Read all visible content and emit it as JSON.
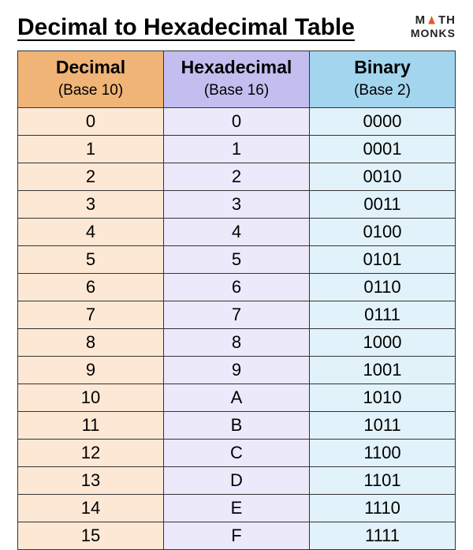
{
  "title": "Decimal to Hexadecimal Table",
  "logo": {
    "line1_left": "M",
    "line1_right": "TH",
    "line2": "MONKS"
  },
  "columns": [
    {
      "name": "Decimal",
      "base": "(Base 10)"
    },
    {
      "name": "Hexadecimal",
      "base": "(Base 16)"
    },
    {
      "name": "Binary",
      "base": "(Base 2)"
    }
  ],
  "rows": [
    {
      "decimal": "0",
      "hex": "0",
      "binary": "0000"
    },
    {
      "decimal": "1",
      "hex": "1",
      "binary": "0001"
    },
    {
      "decimal": "2",
      "hex": "2",
      "binary": "0010"
    },
    {
      "decimal": "3",
      "hex": "3",
      "binary": "0011"
    },
    {
      "decimal": "4",
      "hex": "4",
      "binary": "0100"
    },
    {
      "decimal": "5",
      "hex": "5",
      "binary": "0101"
    },
    {
      "decimal": "6",
      "hex": "6",
      "binary": "0110"
    },
    {
      "decimal": "7",
      "hex": "7",
      "binary": "0111"
    },
    {
      "decimal": "8",
      "hex": "8",
      "binary": "1000"
    },
    {
      "decimal": "9",
      "hex": "9",
      "binary": "1001"
    },
    {
      "decimal": "10",
      "hex": "A",
      "binary": "1010"
    },
    {
      "decimal": "11",
      "hex": "B",
      "binary": "1011"
    },
    {
      "decimal": "12",
      "hex": "C",
      "binary": "1100"
    },
    {
      "decimal": "13",
      "hex": "D",
      "binary": "1101"
    },
    {
      "decimal": "14",
      "hex": "E",
      "binary": "1110"
    },
    {
      "decimal": "15",
      "hex": "F",
      "binary": "1111"
    }
  ]
}
